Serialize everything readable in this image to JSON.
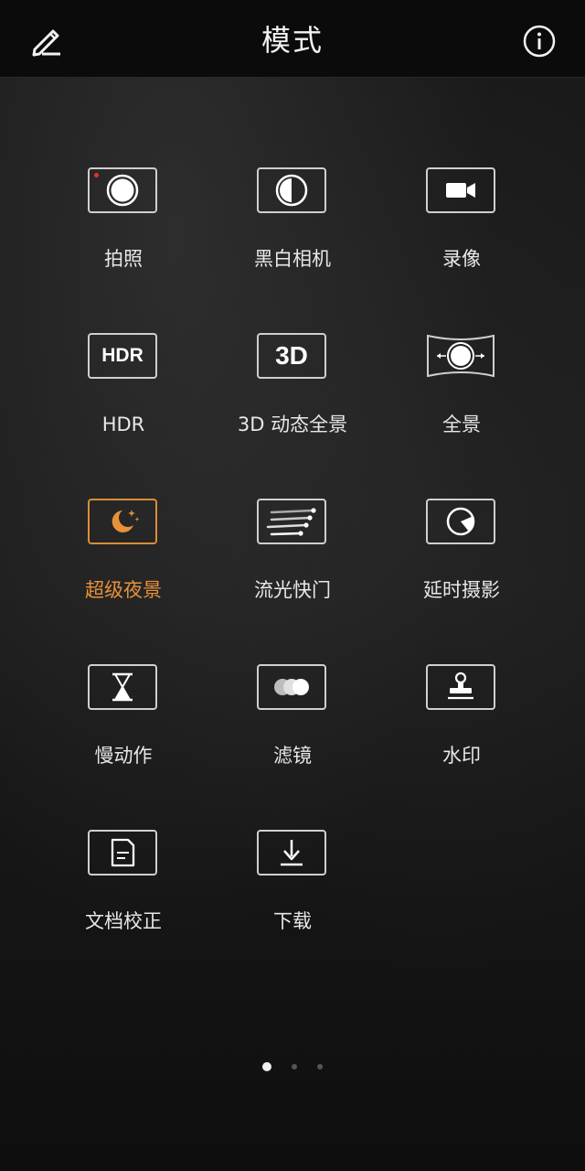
{
  "header": {
    "title": "模式",
    "edit_icon": "pencil-icon",
    "info_icon": "info-icon"
  },
  "modes": [
    {
      "label": "拍照",
      "icon": "photo-shutter-icon",
      "active": false
    },
    {
      "label": "黑白相机",
      "icon": "monochrome-icon",
      "active": false
    },
    {
      "label": "录像",
      "icon": "video-camera-icon",
      "active": false
    },
    {
      "label": "HDR",
      "icon": "hdr-icon",
      "icon_text": "HDR",
      "active": false
    },
    {
      "label": "3D 动态全景",
      "icon": "3d-icon",
      "icon_text": "3D",
      "active": false
    },
    {
      "label": "全景",
      "icon": "panorama-icon",
      "active": false
    },
    {
      "label": "超级夜景",
      "icon": "night-moon-icon",
      "active": true
    },
    {
      "label": "流光快门",
      "icon": "light-trails-icon",
      "active": false
    },
    {
      "label": "延时摄影",
      "icon": "timelapse-icon",
      "active": false
    },
    {
      "label": "慢动作",
      "icon": "hourglass-icon",
      "active": false
    },
    {
      "label": "滤镜",
      "icon": "filter-circles-icon",
      "active": false
    },
    {
      "label": "水印",
      "icon": "stamp-icon",
      "active": false
    },
    {
      "label": "文档校正",
      "icon": "document-icon",
      "active": false
    },
    {
      "label": "下载",
      "icon": "download-icon",
      "active": false
    }
  ],
  "pager": {
    "pages": 3,
    "current": 1
  },
  "colors": {
    "accent": "#e8913a",
    "recording_dot": "#e0342c",
    "icon_border": "#cfcfcf",
    "topbar_bg": "#0b0b0b"
  }
}
